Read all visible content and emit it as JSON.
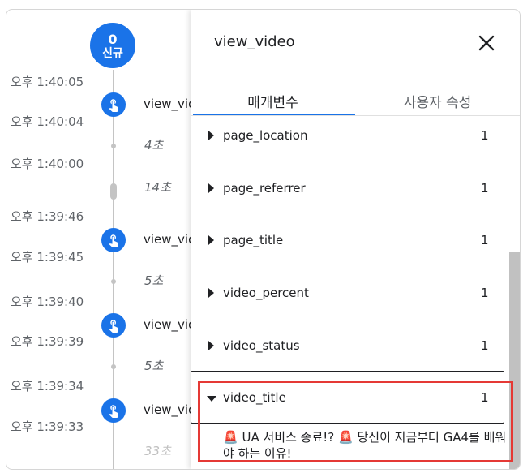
{
  "timeline": {
    "badge": {
      "count": "0",
      "label": "신규"
    },
    "times": [
      "오후 1:40:05",
      "오후 1:40:04",
      "오후 1:40:00",
      "오후 1:39:46",
      "오후 1:39:45",
      "오후 1:39:40",
      "오후 1:39:39",
      "오후 1:39:34",
      "오후 1:39:33"
    ],
    "events": [
      "view_vid",
      "view_vid",
      "view_vid",
      "view_vid"
    ],
    "durations": [
      "4초",
      "14초",
      "5초",
      "5초",
      "33초"
    ]
  },
  "panel": {
    "title": "view_video",
    "tabs": [
      "매개변수",
      "사용자 속성"
    ],
    "params": [
      {
        "name": "page_location",
        "count": "1"
      },
      {
        "name": "page_referrer",
        "count": "1"
      },
      {
        "name": "page_title",
        "count": "1"
      },
      {
        "name": "video_percent",
        "count": "1"
      },
      {
        "name": "video_status",
        "count": "1"
      },
      {
        "name": "video_title",
        "count": "1"
      }
    ],
    "expanded_value": {
      "siren": "🚨",
      "part1": "UA 서비스 종료!?",
      "part2": "당신이 지금부터 GA4를 배워야 하는 이유!"
    }
  },
  "colors": {
    "accent": "#1a73e8",
    "highlight": "#e53935"
  }
}
